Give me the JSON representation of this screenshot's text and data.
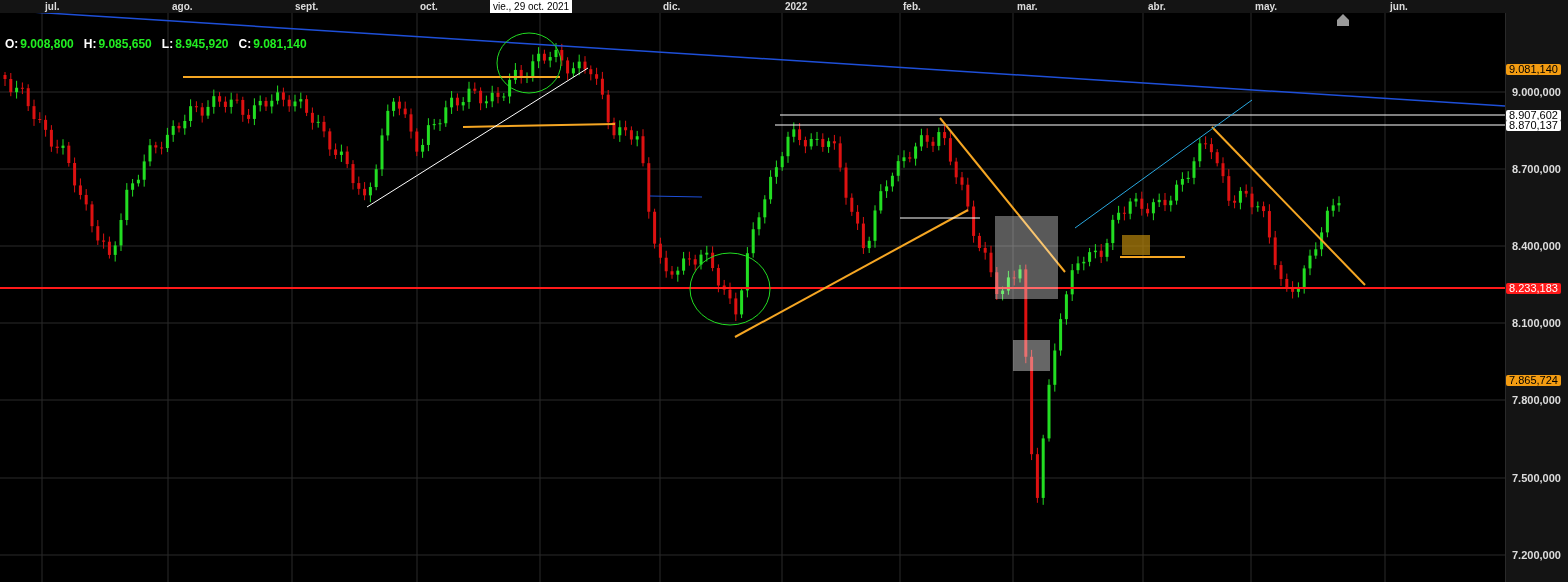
{
  "time_axis": {
    "months": [
      "jul.",
      "ago.",
      "sept.",
      "oct.",
      "dic.",
      "2022",
      "feb.",
      "mar.",
      "abr.",
      "may.",
      "jun."
    ]
  },
  "crosshair_date": "vie., 29 oct. 2021",
  "ohlc": [
    {
      "label": "O:",
      "value": "9.008,800"
    },
    {
      "label": "H:",
      "value": "9.085,650"
    },
    {
      "label": "L:",
      "value": "8.945,920"
    },
    {
      "label": "C:",
      "value": "9.081,140"
    }
  ],
  "price_axis": {
    "ticks": [
      "9.000,000",
      "8.700,000",
      "8.400,000",
      "8.100,000",
      "7.800,000",
      "7.500,000",
      "7.200,000"
    ]
  },
  "price_tags": [
    {
      "value": "9.081,140",
      "color": "#f39c12"
    },
    {
      "value": "8.907,602",
      "color": "#ffffff"
    },
    {
      "value": "8.870,137",
      "color": "#ffffff"
    },
    {
      "value": "8.233,183",
      "color": "#ff1a1a"
    },
    {
      "value": "7.865,724",
      "color": "#f39c12"
    }
  ]
}
